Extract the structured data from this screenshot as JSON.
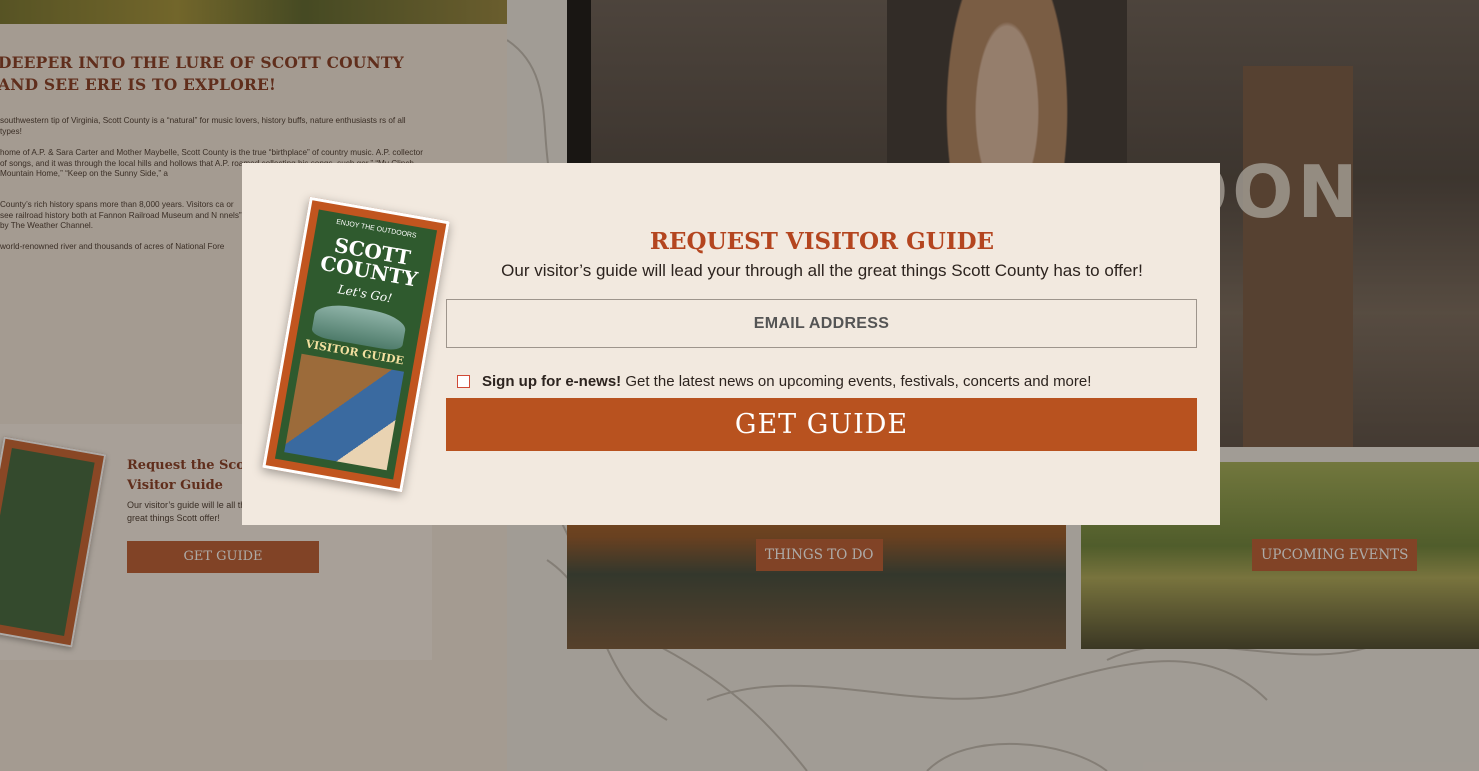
{
  "page": {
    "lure_heading": "DEEPER INTO THE LURE OF SCOTT COUNTY AND SEE ERE IS TO EXPLORE!",
    "paragraphs": [
      "southwestern tip of Virginia, Scott County is a “natural” for music lovers, history buffs, nature enthusiasts rs of all types!",
      "home of A.P. & Sara Carter and Mother Maybelle, Scott County is the true “birthplace” of country music. A.P. collector of songs, and it was through the local hills and hollows that A.P. roamed collecting his songs, such ger,” “My Clinch Mountain Home,” “Keep on the Sunny Side,” a",
      "County’s rich history spans more than 8,000 years. Visitors ca or see railroad history both at Fannon Railroad Museum and N nnels” by The Weather Channel.",
      "world-renowned river and thousands of acres of National Fore"
    ],
    "card": {
      "title": "Request the Scot Visitor Guide",
      "description": "Our visitor’s guide will le all the great things Scott offer!",
      "button": "GET GUIDE"
    },
    "video": {
      "sign_text": "OON"
    },
    "tiles": [
      {
        "label": "THINGS TO DO"
      },
      {
        "label": "UPCOMING EVENTS"
      }
    ]
  },
  "modal": {
    "title": "REQUEST VISITOR GUIDE",
    "subtitle": "Our visitor’s guide will lead your through all the great things Scott County has to offer!",
    "email_placeholder": "EMAIL ADDRESS",
    "optin_strong": "Sign up for e-news!",
    "optin_text": " Get the latest news on upcoming events, festivals, concerts and more!",
    "button": "GET GUIDE",
    "brochure": {
      "top_text": "ENJOY THE OUTDOORS",
      "title": "SCOTT COUNTY",
      "slogan": "Let's Go!",
      "label": "VISITOR GUIDE"
    }
  },
  "colors": {
    "accent": "#b8521f",
    "heading": "#b4451f",
    "modal_bg": "#f2e9df"
  }
}
